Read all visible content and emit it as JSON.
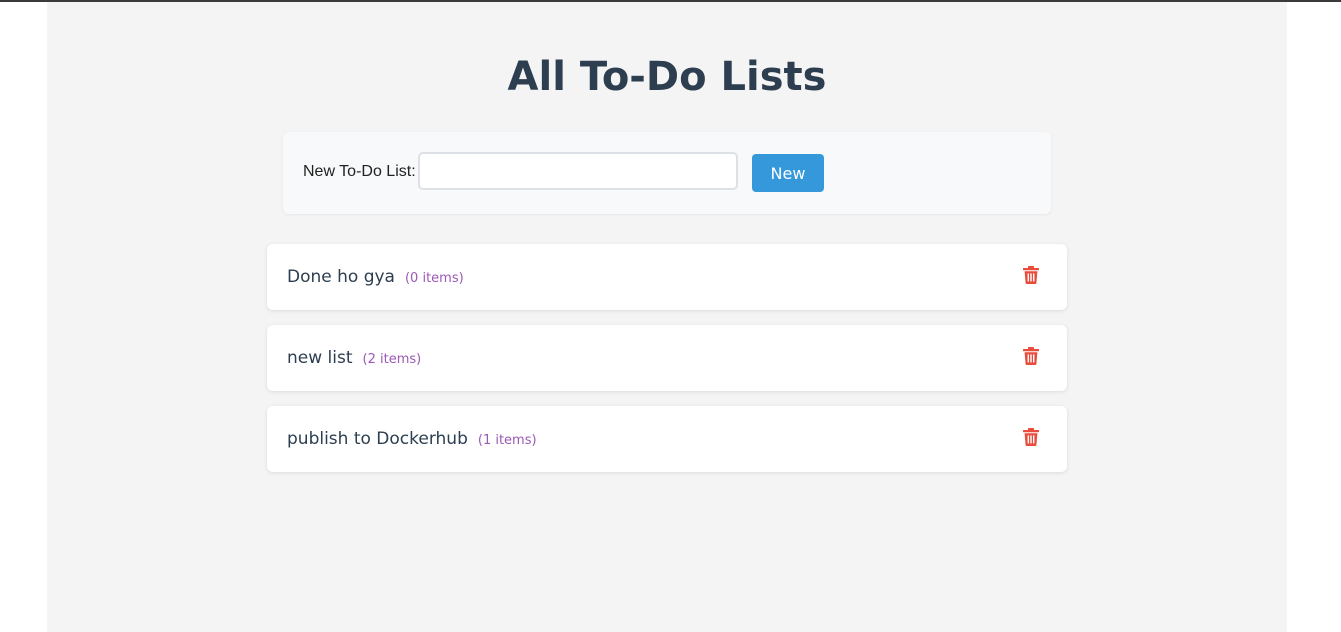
{
  "page": {
    "title": "All To-Do Lists"
  },
  "new_list_form": {
    "label": "New To-Do List:",
    "input_value": "",
    "input_placeholder": "",
    "button_label": "New"
  },
  "lists": [
    {
      "name": "Done ho gya",
      "count_label": "(0 items)"
    },
    {
      "name": "new list",
      "count_label": "(2 items)"
    },
    {
      "name": "publish to Dockerhub",
      "count_label": "(1 items)"
    }
  ],
  "icons": {
    "delete": "trash-icon"
  },
  "colors": {
    "title": "#2c3e50",
    "button": "#3498db",
    "count": "#9b59b6",
    "delete": "#e74c3c"
  }
}
